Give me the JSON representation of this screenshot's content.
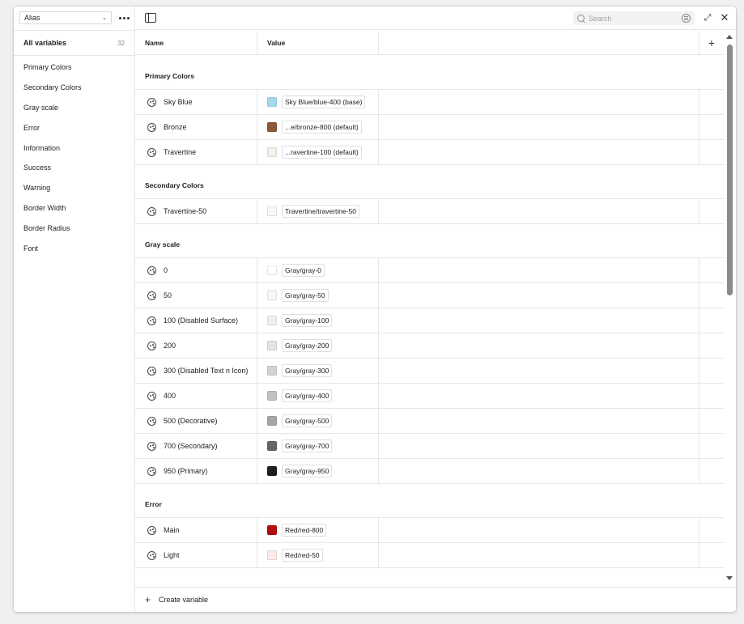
{
  "sidebar": {
    "collection": "Alias",
    "all_variables": {
      "label": "All variables",
      "count": "32"
    },
    "groups": [
      "Primary Colors",
      "Secondary Colors",
      "Gray scale",
      "Error",
      "Information",
      "Success",
      "Warning",
      "Border Width",
      "Border Radius",
      "Font"
    ]
  },
  "toolbar": {
    "search_placeholder": "Search"
  },
  "table": {
    "columns": {
      "name": "Name",
      "value": "Value"
    },
    "groups": [
      {
        "title": "Primary Colors",
        "rows": [
          {
            "name": "Sky Blue",
            "value": "Sky Blue/blue-400 (base)",
            "color": "#a8d8f0"
          },
          {
            "name": "Bronze",
            "value": "...e/bronze-800 (default)",
            "color": "#8b5a36"
          },
          {
            "name": "Travertine",
            "value": "...ravertine-100 (default)",
            "color": "#f4efe7"
          }
        ]
      },
      {
        "title": "Secondary Colors",
        "rows": [
          {
            "name": "Travertine-50",
            "value": "Travertine/travertine-50",
            "color": "#faf8f4"
          }
        ]
      },
      {
        "title": "Gray scale",
        "rows": [
          {
            "name": "0",
            "value": "Gray/gray-0",
            "color": "#ffffff"
          },
          {
            "name": "50",
            "value": "Gray/gray-50",
            "color": "#f8f8f8"
          },
          {
            "name": "100 (Disabled Surface)",
            "value": "Gray/gray-100",
            "color": "#f0f0f0"
          },
          {
            "name": "200",
            "value": "Gray/gray-200",
            "color": "#e5e5e5"
          },
          {
            "name": "300 (Disabled Text n Icon)",
            "value": "Gray/gray-300",
            "color": "#d4d4d4"
          },
          {
            "name": "400",
            "value": "Gray/gray-400",
            "color": "#c2c2c2"
          },
          {
            "name": "500 (Decorative)",
            "value": "Gray/gray-500",
            "color": "#a6a6a6"
          },
          {
            "name": "700 (Secondary)",
            "value": "Gray/gray-700",
            "color": "#666666"
          },
          {
            "name": "950 (Primary)",
            "value": "Gray/gray-950",
            "color": "#1e1e1e"
          }
        ]
      },
      {
        "title": "Error",
        "rows": [
          {
            "name": "Main",
            "value": "Red/red-800",
            "color": "#b20d0d"
          },
          {
            "name": "Light",
            "value": "Red/red-50",
            "color": "#fdeaea"
          }
        ]
      }
    ]
  },
  "footer": {
    "create_label": "Create variable"
  }
}
